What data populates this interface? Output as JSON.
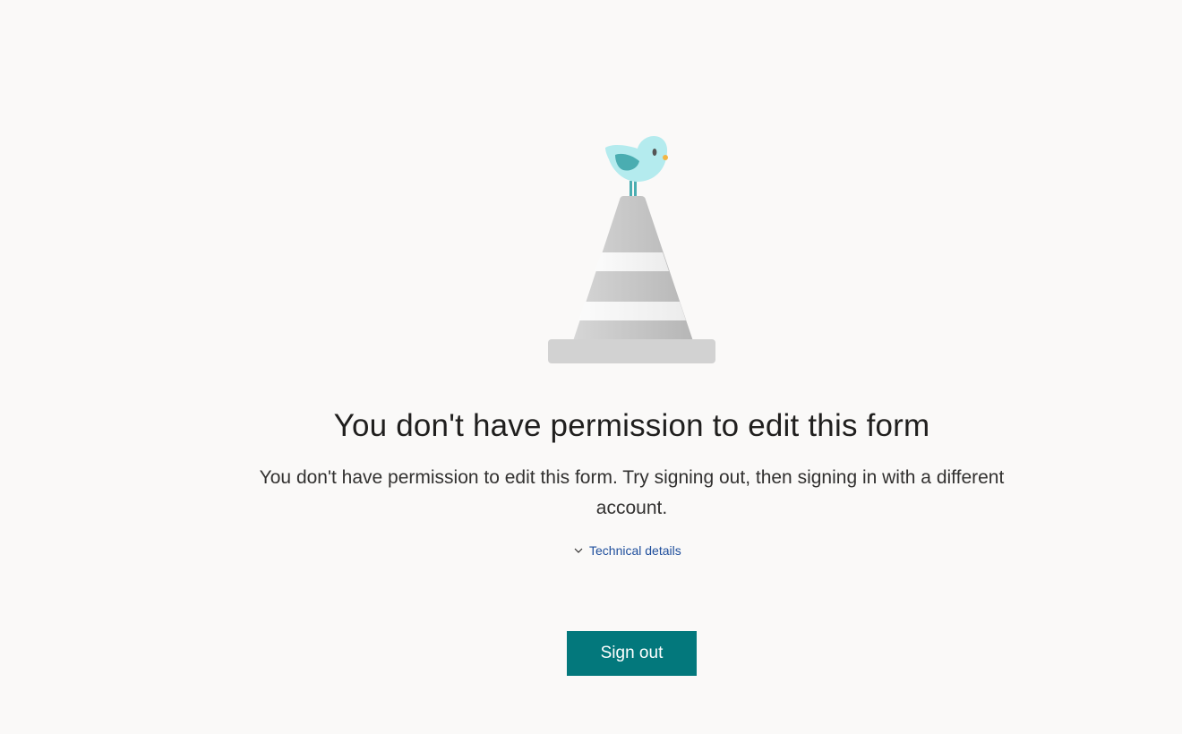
{
  "error": {
    "title": "You don't have permission to edit this form",
    "message": "You don't have permission to edit this form. Try signing out, then signing in with a different account."
  },
  "technical_details": {
    "label": "Technical details",
    "icon": "chevron-down-icon"
  },
  "actions": {
    "sign_out_label": "Sign out"
  },
  "illustration": {
    "icon": "bird-on-traffic-cone-illustration"
  },
  "colors": {
    "background": "#faf9f8",
    "primary_button": "#03787c",
    "link": "#1e4e9c",
    "bird": "#b4ebee",
    "bird_wing": "#4aadb1",
    "cone": "#c8c8c8"
  }
}
